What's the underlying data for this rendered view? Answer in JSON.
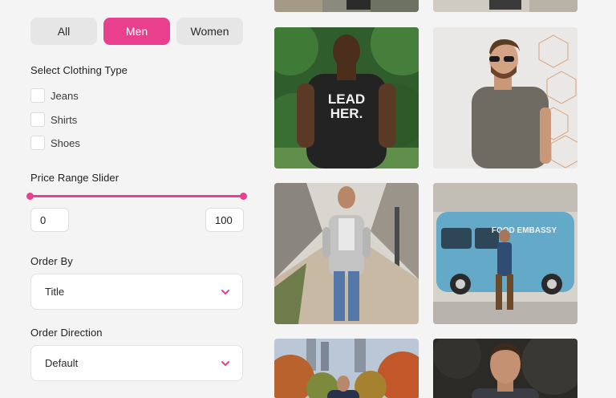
{
  "filter": {
    "gender_tabs": [
      {
        "label": "All",
        "active": false
      },
      {
        "label": "Men",
        "active": true
      },
      {
        "label": "Women",
        "active": false
      }
    ],
    "clothing_type": {
      "title": "Select Clothing Type",
      "options": [
        {
          "label": "Jeans",
          "checked": false
        },
        {
          "label": "Shirts",
          "checked": false
        },
        {
          "label": "Shoes",
          "checked": false
        }
      ]
    },
    "price": {
      "title": "Price Range Slider",
      "min": "0",
      "max": "100"
    },
    "order_by": {
      "title": "Order By",
      "value": "Title"
    },
    "order_direction": {
      "title": "Order Direction",
      "value": "Default"
    }
  },
  "grid": {
    "photos": [
      {
        "name": "photo-partial-top-left",
        "shirt_text": ""
      },
      {
        "name": "photo-partial-top-right",
        "shirt_text": ""
      },
      {
        "name": "photo-man-tshirt-leader",
        "shirt_text": "LEAD HER."
      },
      {
        "name": "photo-man-sunglasses",
        "shirt_text": ""
      },
      {
        "name": "photo-man-grey-coat-street",
        "shirt_text": ""
      },
      {
        "name": "photo-man-food-truck",
        "shirt_text": ""
      },
      {
        "name": "photo-man-autumn-park",
        "shirt_text": ""
      },
      {
        "name": "photo-man-portrait-dark",
        "shirt_text": ""
      }
    ],
    "van_sign": "FOOD EMBASSY"
  },
  "colors": {
    "accent": "#e8408c"
  }
}
